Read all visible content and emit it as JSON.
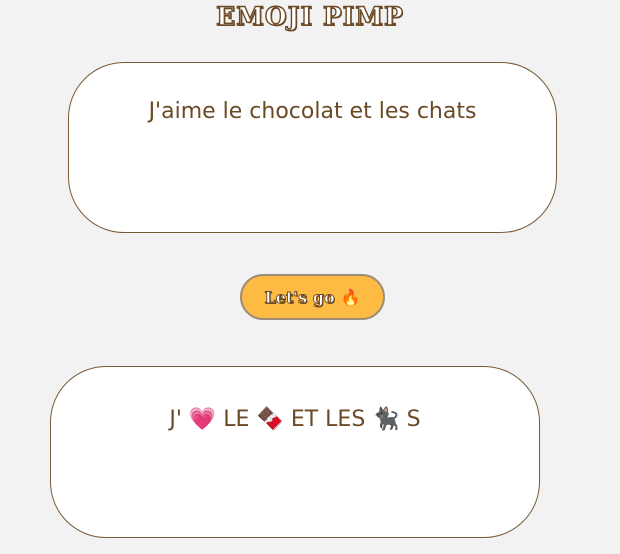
{
  "header": {
    "title": "EMOJI PIMP"
  },
  "input": {
    "text": "J'aime le chocolat et les chats"
  },
  "action": {
    "label": "Let's go",
    "emoji": "🔥"
  },
  "output": {
    "text": "J' 💗 LE 🍫 ET LES 🐈‍⬛ S"
  },
  "colors": {
    "background": "#f2f2f2",
    "accent": "#fdbb44",
    "text": "#6b4a25",
    "border": "#7a5a36"
  }
}
